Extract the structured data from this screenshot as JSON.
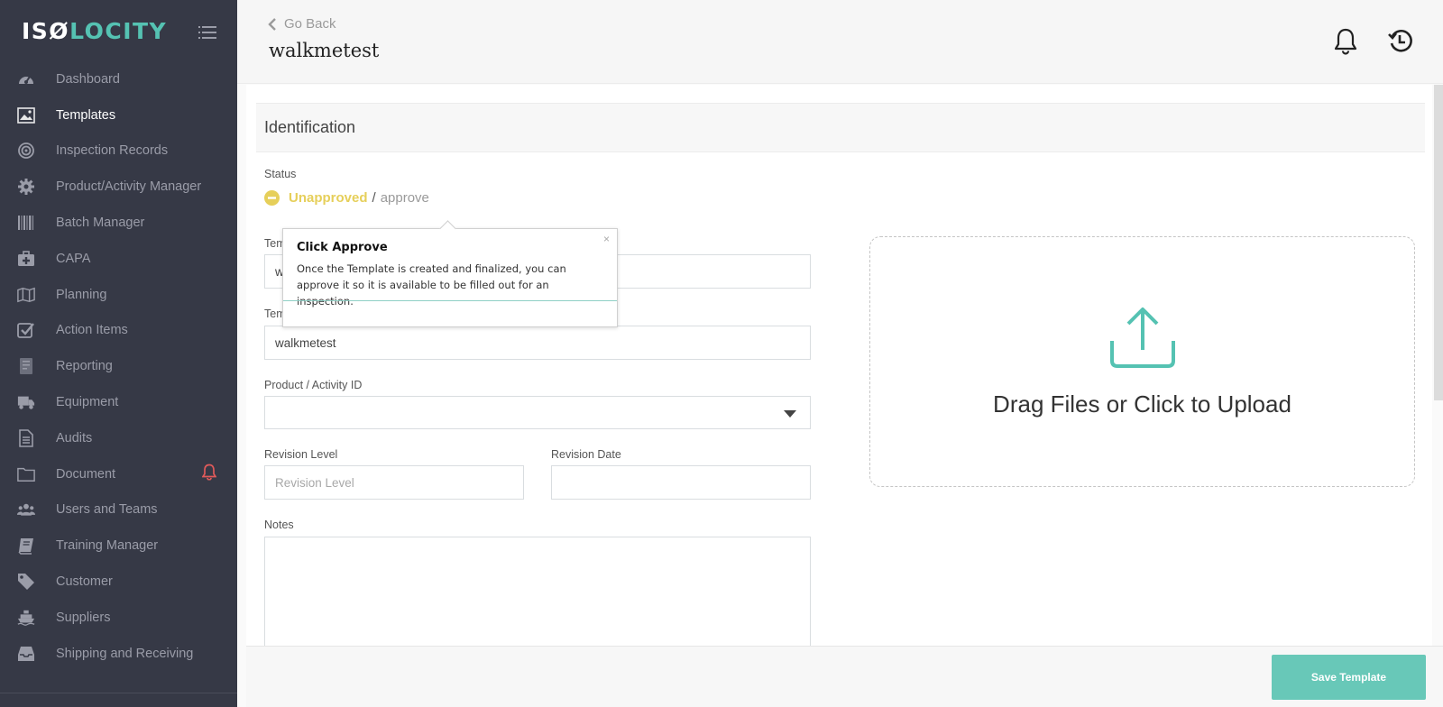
{
  "app": {
    "logo_white": "ISØ",
    "logo_teal": "LOCITY"
  },
  "sidebar": {
    "items": [
      {
        "label": "Dashboard",
        "icon": "dashboard-icon"
      },
      {
        "label": "Templates",
        "icon": "image-icon",
        "active": true
      },
      {
        "label": "Inspection Records",
        "icon": "target-icon"
      },
      {
        "label": "Product/Activity Manager",
        "icon": "gear-icon"
      },
      {
        "label": "Batch Manager",
        "icon": "barcode-icon"
      },
      {
        "label": "CAPA",
        "icon": "medkit-icon"
      },
      {
        "label": "Planning",
        "icon": "map-icon"
      },
      {
        "label": "Action Items",
        "icon": "checkbox-icon"
      },
      {
        "label": "Reporting",
        "icon": "report-icon"
      },
      {
        "label": "Equipment",
        "icon": "truck-icon"
      },
      {
        "label": "Audits",
        "icon": "document-icon"
      },
      {
        "label": "Document",
        "icon": "folder-icon",
        "alert": true
      },
      {
        "label": "Users and Teams",
        "icon": "users-icon"
      },
      {
        "label": "Training Manager",
        "icon": "book-icon"
      },
      {
        "label": "Customer",
        "icon": "tag-icon"
      },
      {
        "label": "Suppliers",
        "icon": "ship-icon"
      },
      {
        "label": "Shipping and Receiving",
        "icon": "inbox-icon"
      }
    ],
    "alert_color": "#e05a5a"
  },
  "header": {
    "back_label": "Go Back",
    "title": "walkmetest"
  },
  "section": {
    "title": "Identification"
  },
  "status": {
    "label": "Status",
    "value": "Unapproved",
    "separator": "/",
    "action": "approve",
    "color": "#e6cf5a"
  },
  "form": {
    "template_id_label": "Tem",
    "template_id_value": "w",
    "template_name_label": "Tem",
    "template_name_value": "walkmetest",
    "product_label": "Product / Activity ID",
    "product_value": "",
    "revision_level_label": "Revision Level",
    "revision_level_placeholder": "Revision Level",
    "revision_date_label": "Revision Date",
    "revision_date_value": "",
    "notes_label": "Notes",
    "notes_value": ""
  },
  "tooltip": {
    "title": "Click Approve",
    "body": "Once the Template is created and finalized, you can approve it so it is available to be filled out for an inspection.",
    "close": "×"
  },
  "upload": {
    "text": "Drag Files or Click to Upload",
    "accent": "#55c2b2"
  },
  "footer": {
    "save_label": "Save Template",
    "save_color": "#68c8b8"
  }
}
